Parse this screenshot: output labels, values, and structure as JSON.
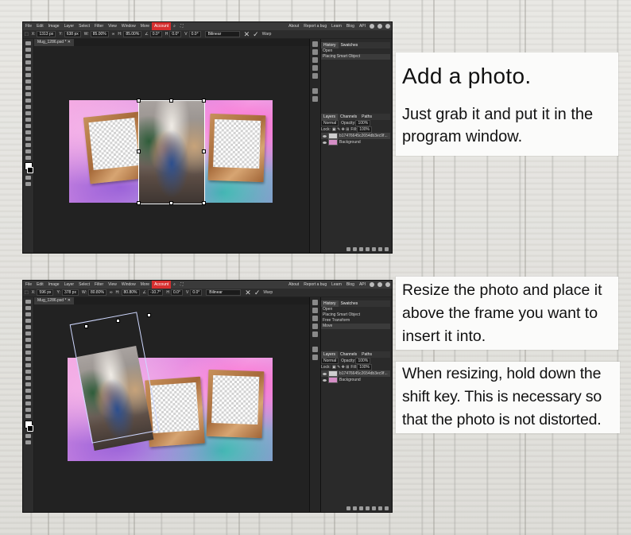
{
  "menu": {
    "items": [
      "File",
      "Edit",
      "Image",
      "Layer",
      "Select",
      "Filter",
      "View",
      "Window",
      "More"
    ],
    "account": "Account",
    "right": [
      "About",
      "Report a bug",
      "Learn",
      "Blog",
      "API"
    ]
  },
  "top": {
    "options": {
      "x_label": "X:",
      "x": "1313 px",
      "y_label": "Y:",
      "y": "638 px",
      "w_label": "W:",
      "w": "85.00%",
      "h_label": "H:",
      "h": "85.00%",
      "rot": "0.0°",
      "skew_h": "0.0°",
      "skew_v": "0.0°",
      "interp": "Bilinear",
      "warp": "Warp"
    },
    "tab": "Mug_1286.psd * ✕",
    "history_tabs": [
      "History",
      "Swatches"
    ],
    "history": [
      "Open",
      "Placing Smart Object"
    ],
    "layers_tabs": [
      "Layers",
      "Channels",
      "Paths"
    ],
    "blend": "Normal",
    "opacity_label": "Opacity:",
    "opacity": "100%",
    "lock_label": "Lock:",
    "fill_label": "Fill:",
    "fill": "100%",
    "layers": [
      "b17476645c2654db3ec9f...",
      "Background"
    ]
  },
  "bottom": {
    "options": {
      "x_label": "X:",
      "x": "596 px",
      "y_label": "Y:",
      "y": "378 px",
      "w_label": "W:",
      "w": "80.80%",
      "h_label": "H:",
      "h": "80.80%",
      "rot": "-10.7°",
      "skew_h": "0.0°",
      "skew_v": "0.0°",
      "interp": "Bilinear",
      "warp": "Warp"
    },
    "tab": "Mug_1286.psd * ✕",
    "history_tabs": [
      "History",
      "Swatches"
    ],
    "history": [
      "Open",
      "Placing Smart Object",
      "Free Transform",
      "Move"
    ],
    "layers_tabs": [
      "Layers",
      "Channels",
      "Paths"
    ],
    "blend": "Normal",
    "opacity_label": "Opacity:",
    "opacity": "100%",
    "lock_label": "Lock:",
    "fill_label": "Fill:",
    "fill": "100%",
    "layers": [
      "b17476645c2654db3ec9f...",
      "Background"
    ]
  },
  "captions": {
    "c1_title": "Add a photo.",
    "c1_body": "Just grab it and put it in the program window.",
    "c2_body": "Resize the photo and place it above the frame you want to insert it into.",
    "c3_body": "When resizing, hold down the shift key. This is necessary so that the photo is not distorted."
  },
  "colors": {
    "account": "#d62f2f",
    "editor_bg": "#1e1e1e"
  }
}
